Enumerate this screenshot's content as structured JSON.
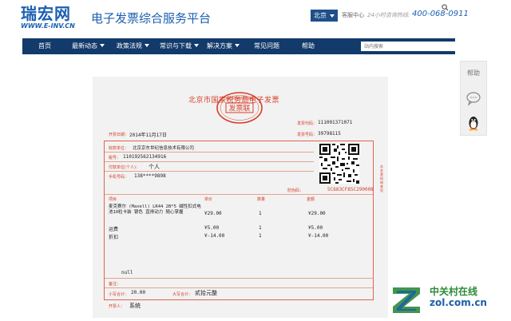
{
  "header": {
    "logo_text": "瑞宏网",
    "logo_url": "WWW.E-INV.CN",
    "site_title": "电子发票综合服务平台",
    "city": "北京",
    "service_center": "客服中心",
    "hotline_label": "24小时咨询热线:",
    "hotline": "400-068-0911"
  },
  "nav": {
    "items": [
      {
        "label": "首页",
        "dropdown": false
      },
      {
        "label": "最新动态",
        "dropdown": true
      },
      {
        "label": "政策法规",
        "dropdown": true
      },
      {
        "label": "常识与下载",
        "dropdown": true
      },
      {
        "label": "解决方案",
        "dropdown": true
      },
      {
        "label": "常见问题",
        "dropdown": false
      },
      {
        "label": "帮助",
        "dropdown": false
      }
    ],
    "search_placeholder": "站内搜索"
  },
  "invoice": {
    "title": "北京市国家税务局电子发票",
    "stamp_center": "发票联",
    "stamp_ring": "北京市国家税务局监制",
    "invoice_code_label": "发票代码：",
    "invoice_code": "111001371071",
    "issue_date_label": "开票日期：",
    "issue_date": "2014年11月17日",
    "invoice_number_label": "发票号码：",
    "invoice_number": "39798115",
    "seller_label": "收款单位：",
    "seller": "北京京东世纪信息技术有限公司",
    "tax_no_label": "税号：",
    "tax_no": "110192562134916",
    "payer_label": "付款单位(个人)：",
    "payer": "个人",
    "phone_label": "手机号码：",
    "phone": "138****9898",
    "verify_label": "防伪码：",
    "verify_code": "5C683CF85C290008",
    "col_item": "项目",
    "col_price": "单价",
    "col_qty": "数量",
    "col_amount": "金额",
    "rows": [
      {
        "item": "麦克赛尔 (Maxell) LR44 2B*5 碱性扣式电池10粒卡装 银色 直排动力 随心掌握",
        "price": "¥29.00",
        "qty": "1",
        "amount": "¥29.00"
      },
      {
        "item": "运费",
        "price": "¥5.00",
        "qty": "1",
        "amount": "¥5.00"
      },
      {
        "item": "折扣",
        "price": "¥-14.00",
        "qty": "1",
        "amount": "¥-14.00"
      }
    ],
    "null_text": "null",
    "remark_label": "备注：",
    "total_small_label": "小写合计：",
    "total_small": "20.00",
    "total_big_label": "大写合计：",
    "total_big": "贰拾元整",
    "issuer_label": "开票人：",
    "issuer": "系统",
    "side_note": "本发票网络查验"
  },
  "side_panel": {
    "help": "帮助"
  },
  "watermark": {
    "cn": "中关村在线",
    "en": "zol.com.cn"
  },
  "colors": {
    "brand_blue": "#1b5fb0",
    "nav_bg": "#123a6b",
    "invoice_red": "#d63e2a",
    "zol_green": "#2c8a3b"
  }
}
